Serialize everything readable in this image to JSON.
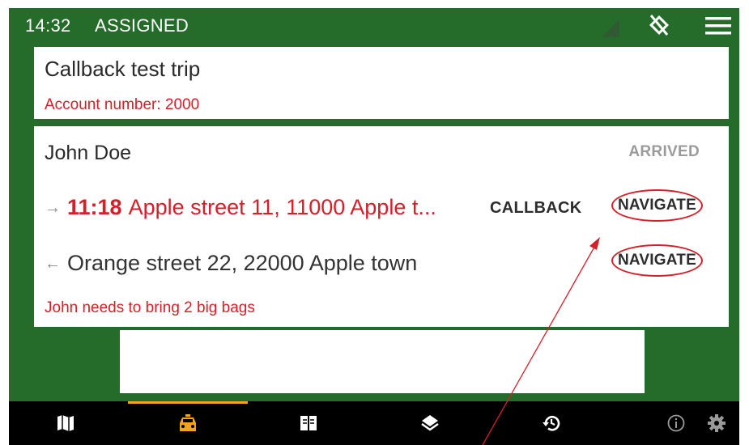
{
  "status_bar": {
    "time": "14:32",
    "state": "ASSIGNED",
    "icons": [
      "signal-icon",
      "screen-rotation-icon",
      "menu-icon"
    ]
  },
  "trip": {
    "title": "Callback test trip",
    "account": "Account number: 2000"
  },
  "passenger": {
    "name": "John Doe",
    "status": "ARRIVED",
    "pickup": {
      "arrow": "→",
      "time": "11:18",
      "address": "Apple street 11, 11000 Apple t...",
      "callback_label": "CALLBACK",
      "navigate_label": "NAVIGATE"
    },
    "dropoff": {
      "arrow": "←",
      "address": "Orange street 22, 22000 Apple town",
      "navigate_label": "NAVIGATE"
    },
    "note": "John needs to bring 2 big bags"
  },
  "bottom_nav": {
    "active_index": 1,
    "items": [
      "map-icon",
      "taxi-icon",
      "book-icon",
      "layers-icon",
      "history-icon",
      "info-icon",
      "settings-icon"
    ]
  },
  "colors": {
    "background": "#256b2a",
    "accent_red": "#d3202a",
    "active_tab": "#f0a61c",
    "nav_bar": "#000000"
  }
}
